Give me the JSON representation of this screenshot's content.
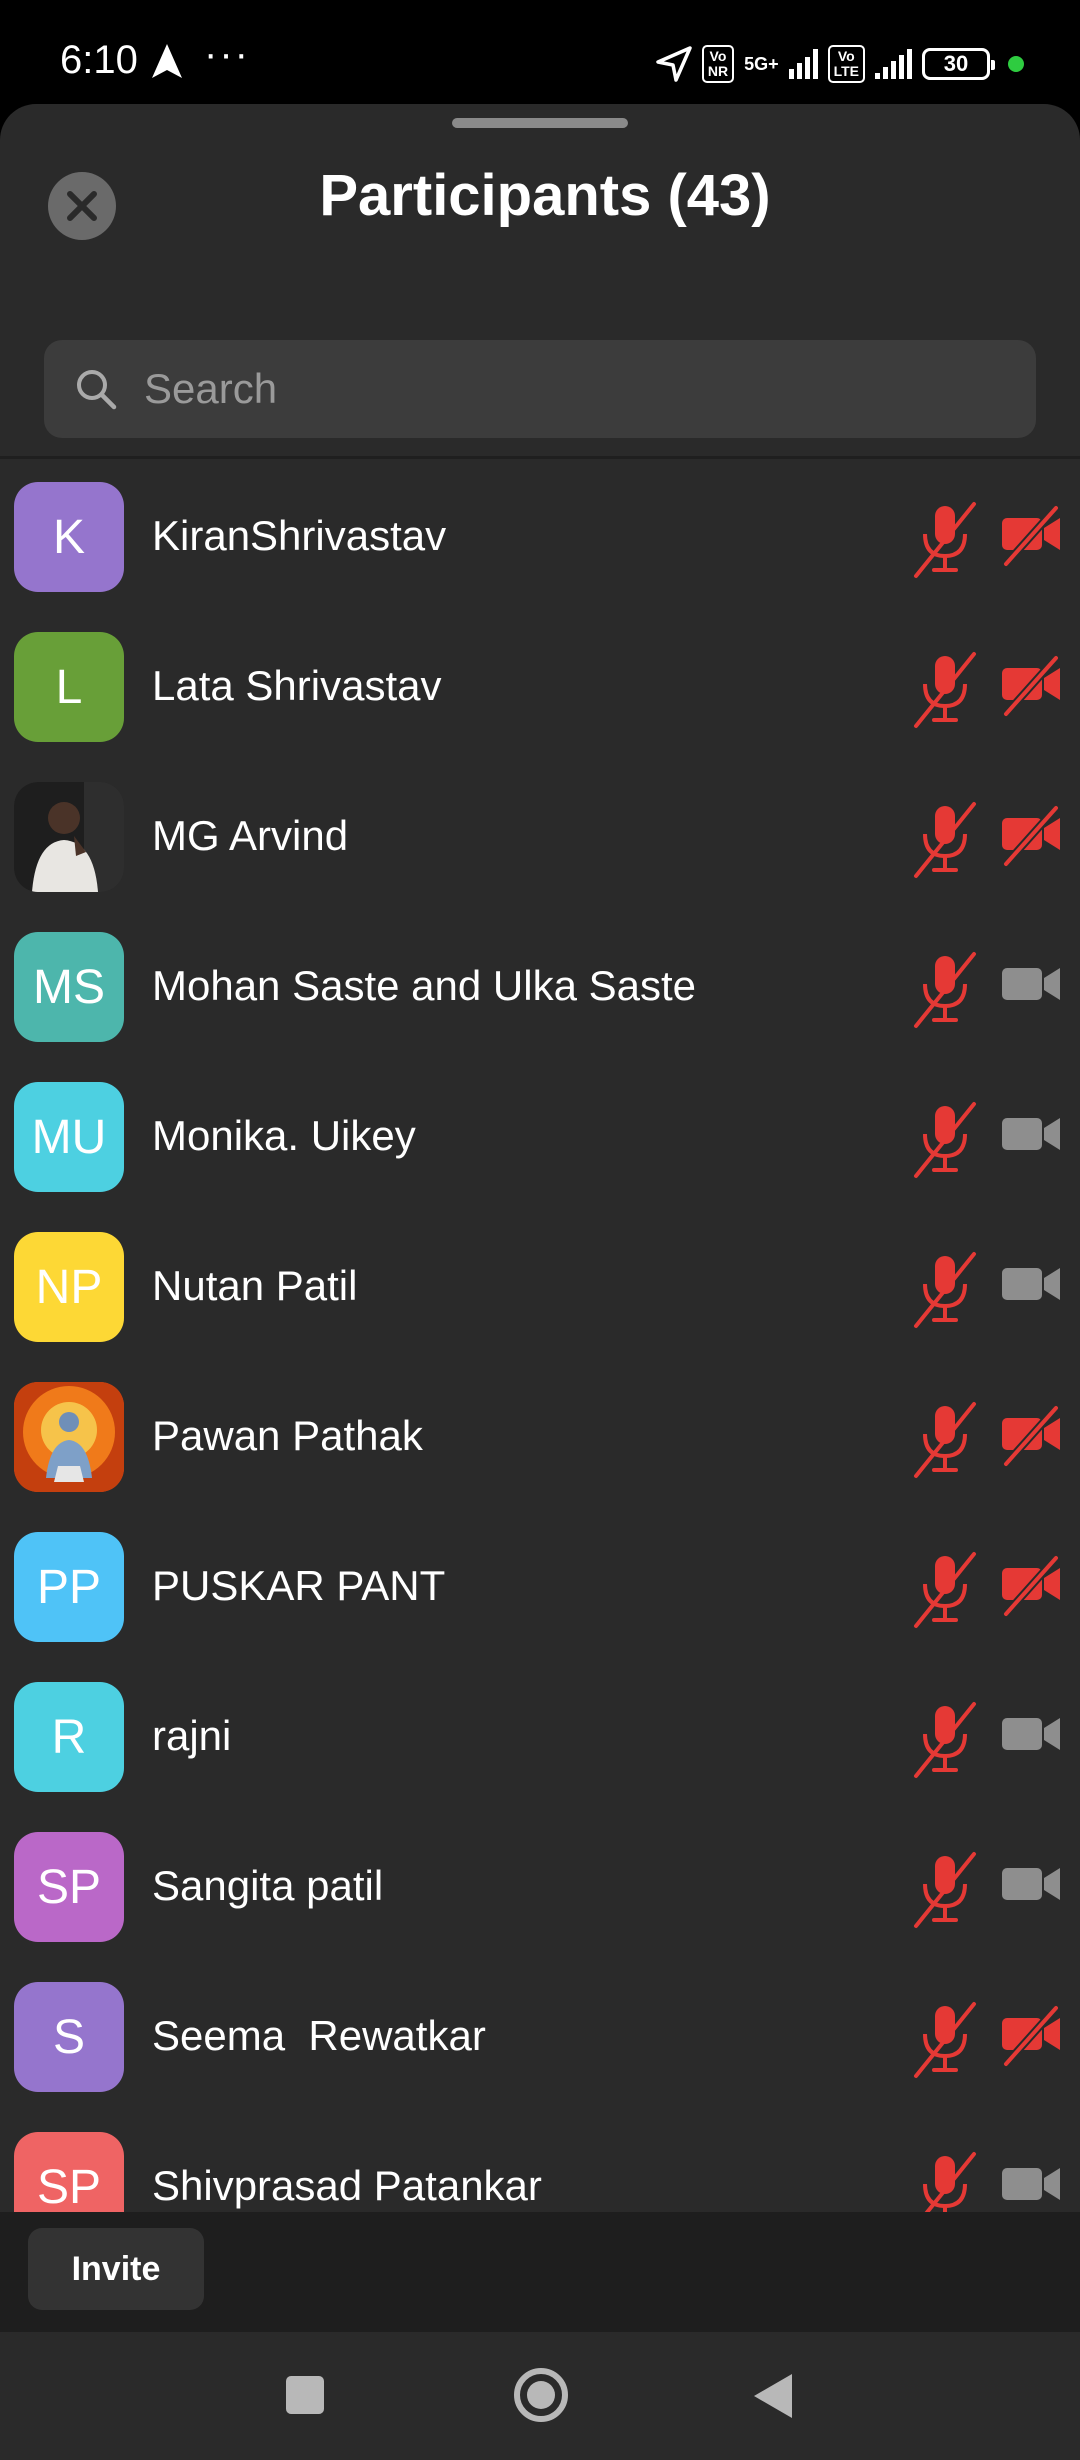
{
  "status_bar": {
    "time": "6:10",
    "dots": "···",
    "badge1": "Vo\nNR",
    "net": "5G+",
    "badge2": "Vo\nLTE",
    "battery": "30"
  },
  "header": {
    "title": "Participants (43)"
  },
  "search": {
    "placeholder": "Search"
  },
  "colors": {
    "sheet_bg": "#2a2a2a",
    "muted_red": "#e53935",
    "camera_grey": "#8e8e8e"
  },
  "participants": [
    {
      "initials": "K",
      "name": "KiranShrivastav",
      "avatar_color": "#9575cd",
      "mic_muted": true,
      "video_off": true
    },
    {
      "initials": "L",
      "name": "Lata Shrivastav",
      "avatar_color": "#689f38",
      "mic_muted": true,
      "video_off": true
    },
    {
      "initials": "",
      "name": "MG Arvind",
      "avatar_color": "#3a3a3a",
      "photo": true,
      "mic_muted": true,
      "video_off": true
    },
    {
      "initials": "MS",
      "name": "Mohan Saste and Ulka Saste",
      "avatar_color": "#4db6ac",
      "mic_muted": true,
      "video_off": false
    },
    {
      "initials": "MU",
      "name": "Monika. Uikey",
      "avatar_color": "#4dd0e1",
      "mic_muted": true,
      "video_off": false
    },
    {
      "initials": "NP",
      "name": "Nutan Patil",
      "avatar_color": "#fdd835",
      "mic_muted": true,
      "video_off": false
    },
    {
      "initials": "",
      "name": "Pawan Pathak",
      "avatar_color": "#e64a19",
      "photo": true,
      "mic_muted": true,
      "video_off": true
    },
    {
      "initials": "PP",
      "name": "PUSKAR PANT",
      "avatar_color": "#4fc3f7",
      "mic_muted": true,
      "video_off": true
    },
    {
      "initials": "R",
      "name": "rajni",
      "avatar_color": "#4dd0e1",
      "mic_muted": true,
      "video_off": false
    },
    {
      "initials": "SP",
      "name": "Sangita patil",
      "avatar_color": "#ba68c8",
      "mic_muted": true,
      "video_off": false
    },
    {
      "initials": "S",
      "name": "Seema  Rewatkar",
      "avatar_color": "#9575cd",
      "mic_muted": true,
      "video_off": true
    },
    {
      "initials": "SP",
      "name": "Shivprasad Patankar",
      "avatar_color": "#ef6464",
      "mic_muted": true,
      "video_off": false
    }
  ],
  "footer": {
    "invite_label": "Invite"
  }
}
